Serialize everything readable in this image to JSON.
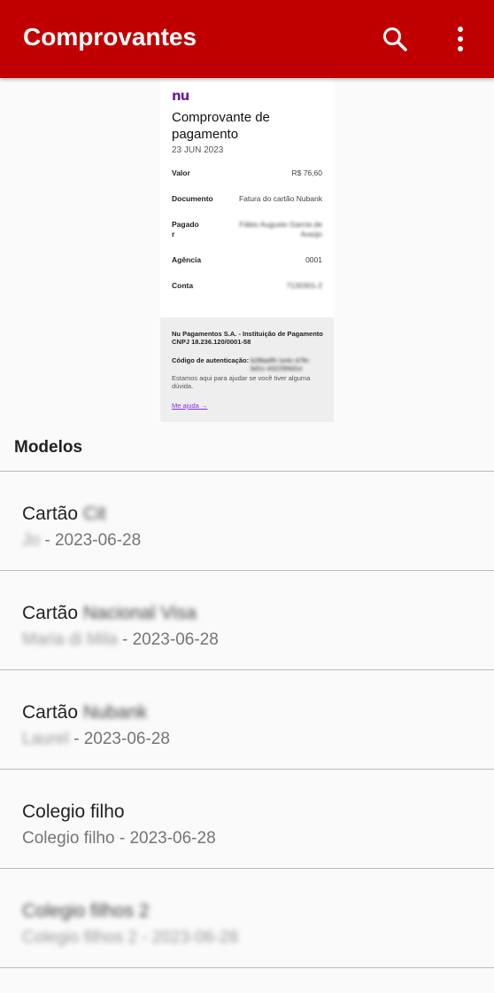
{
  "appbar": {
    "title": "Comprovantes",
    "background": "#c00000",
    "icons": [
      "search-icon",
      "more-vertical-icon"
    ]
  },
  "receipt": {
    "logo": "nu",
    "title": "Comprovante de pagamento",
    "date": "23 JUN 2023",
    "rows": [
      {
        "label": "Valor",
        "value": "R$ 76,60"
      },
      {
        "label": "Documento",
        "value": "Fatura do cartão Nubank"
      },
      {
        "label": "Pagado r",
        "value": "Fábio Augusto Garcia de Araújo"
      },
      {
        "label": "Agência",
        "value": "0001"
      },
      {
        "label": "Conta",
        "value": "7130301-2"
      }
    ],
    "footer": {
      "company": "Nu Pagamentos S.A. - Instituição de Pagamento",
      "cnpj": "CNPJ 18.236.120/0001-58",
      "auth_label": "Código de autenticação:",
      "auth_code": "b2f8a4f5-1e4c-47fe-bd1c-43225f4d1e",
      "support": "Estamos aqui para ajudar se você tiver alguma dúvida.",
      "help_link": "Me ajuda →"
    }
  },
  "section": {
    "title": "Modelos"
  },
  "models": [
    {
      "prefix": "Cartão",
      "name_blurred": "Cit",
      "sub_blurred": "Jo",
      "date": "2023-06-28"
    },
    {
      "prefix": "Cartão",
      "name_blurred": "Nacional Visa",
      "sub_blurred": "Maria di Mila",
      "date": "2023-06-28"
    },
    {
      "prefix": "Cartão",
      "name_blurred": "Nubank",
      "sub_blurred": "Laurel",
      "date": "2023-06-28"
    },
    {
      "title": "Colegio filho",
      "sub": "Colegio filho - 2023-06-28"
    },
    {
      "title_blurred": "Colegio filhos 2",
      "sub_blurred": "Colegio filhos 2 - 2023-06-28"
    }
  ]
}
